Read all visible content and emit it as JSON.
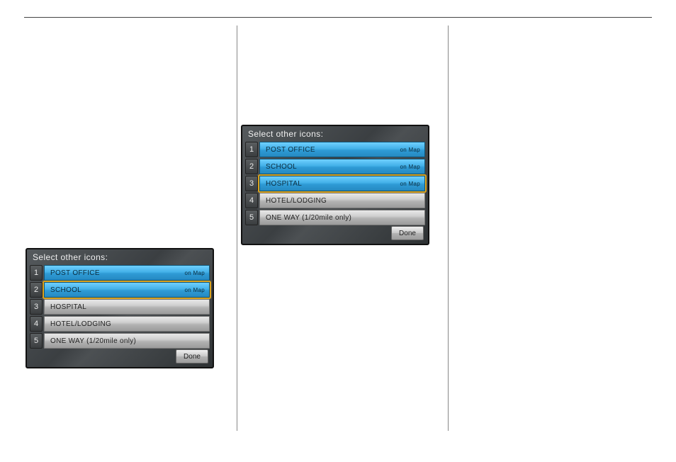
{
  "panel1": {
    "title": "Select other icons:",
    "done": "Done",
    "rows": [
      {
        "n": "1",
        "label": "POST OFFICE",
        "tag": "on Map",
        "selected": true,
        "highlight": false
      },
      {
        "n": "2",
        "label": "SCHOOL",
        "tag": "on Map",
        "selected": true,
        "highlight": true
      },
      {
        "n": "3",
        "label": "HOSPITAL",
        "tag": "",
        "selected": false,
        "highlight": false
      },
      {
        "n": "4",
        "label": "HOTEL/LODGING",
        "tag": "",
        "selected": false,
        "highlight": false
      },
      {
        "n": "5",
        "label": "ONE WAY (1/20mile only)",
        "tag": "",
        "selected": false,
        "highlight": false
      }
    ]
  },
  "panel2": {
    "title": "Select other icons:",
    "done": "Done",
    "rows": [
      {
        "n": "1",
        "label": "POST OFFICE",
        "tag": "on Map",
        "selected": true,
        "highlight": false
      },
      {
        "n": "2",
        "label": "SCHOOL",
        "tag": "on Map",
        "selected": true,
        "highlight": false
      },
      {
        "n": "3",
        "label": "HOSPITAL",
        "tag": "on Map",
        "selected": true,
        "highlight": true
      },
      {
        "n": "4",
        "label": "HOTEL/LODGING",
        "tag": "",
        "selected": false,
        "highlight": false
      },
      {
        "n": "5",
        "label": "ONE WAY (1/20mile only)",
        "tag": "",
        "selected": false,
        "highlight": false
      }
    ]
  }
}
